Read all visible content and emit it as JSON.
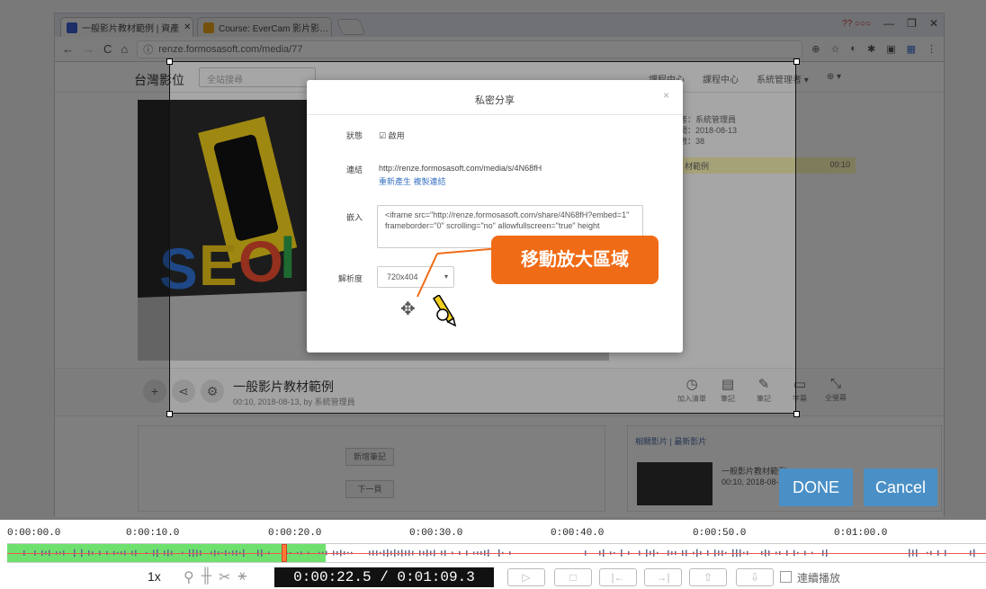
{
  "browser": {
    "tabs": [
      {
        "label": "一般影片教材範例 | 資產",
        "favicon": "#3a5fcd"
      },
      {
        "label": "Course: EverCam 影片影…",
        "favicon": "#e8a41c"
      }
    ],
    "window_controls": {
      "minimize": "—",
      "restore": "❐",
      "close": "✕"
    },
    "tab_extra": "?? ○○○",
    "url": "renze.formosasoft.com/media/77"
  },
  "site": {
    "name": "台灣影位",
    "search_placeholder": "全站搜尋",
    "nav": [
      "課程中心",
      "課程中心",
      "系統管理者 ▾",
      "⊕ ▾"
    ],
    "side_info": [
      "者：系統管理員",
      "間：2018-08-13",
      "數：38"
    ],
    "side_highlight": {
      "label": "材範例",
      "time": "00:10"
    },
    "video_title": "一般影片教材範例",
    "video_meta": "00:10, 2018-08-13, by 系統管理員",
    "actions": [
      "加入清單",
      "筆記",
      "筆記",
      "字幕",
      "全螢幕"
    ],
    "lower_buttons": [
      "新增筆記",
      "下一頁"
    ],
    "related_header": "相關影片 | 最新影片",
    "related_title": "一般影片教材範例",
    "related_sub": "00:10, 2018-08-13"
  },
  "modal": {
    "title": "私密分享",
    "close": "×",
    "status_label": "狀態",
    "status_value": "☑ 啟用",
    "link_label": "連結",
    "link_value": "http://renze.formosasoft.com/media/s/4N68fH",
    "link_actions": "重新產生  複製連結",
    "embed_label": "嵌入",
    "embed_value": "<iframe src=\"http://renze.formosasoft.com/share/4N68fH?embed=1\" frameborder=\"0\" scrolling=\"no\" allowfullscreen=\"true\" height",
    "res_label": "解析度",
    "res_value": "720x404"
  },
  "callout": {
    "text": "移動放大區域",
    "color": "#f06b16"
  },
  "buttons": {
    "done": "DONE",
    "cancel": "Cancel",
    "color": "#4a90c6"
  },
  "timeline": {
    "ticks": [
      "0:00:00.0",
      "0:00:10.0",
      "0:00:20.0",
      "0:00:30.0",
      "0:00:40.0",
      "0:00:50.0",
      "0:01:00.0"
    ],
    "played_fraction": 0.325,
    "zoom": "1x",
    "time_display": "0:00:22.5 / 0:01:09.3",
    "play_controls": [
      "play-icon",
      "stop-icon",
      "prev-icon",
      "next-icon",
      "up-icon",
      "down-icon"
    ],
    "loop_label": "連續播放"
  }
}
